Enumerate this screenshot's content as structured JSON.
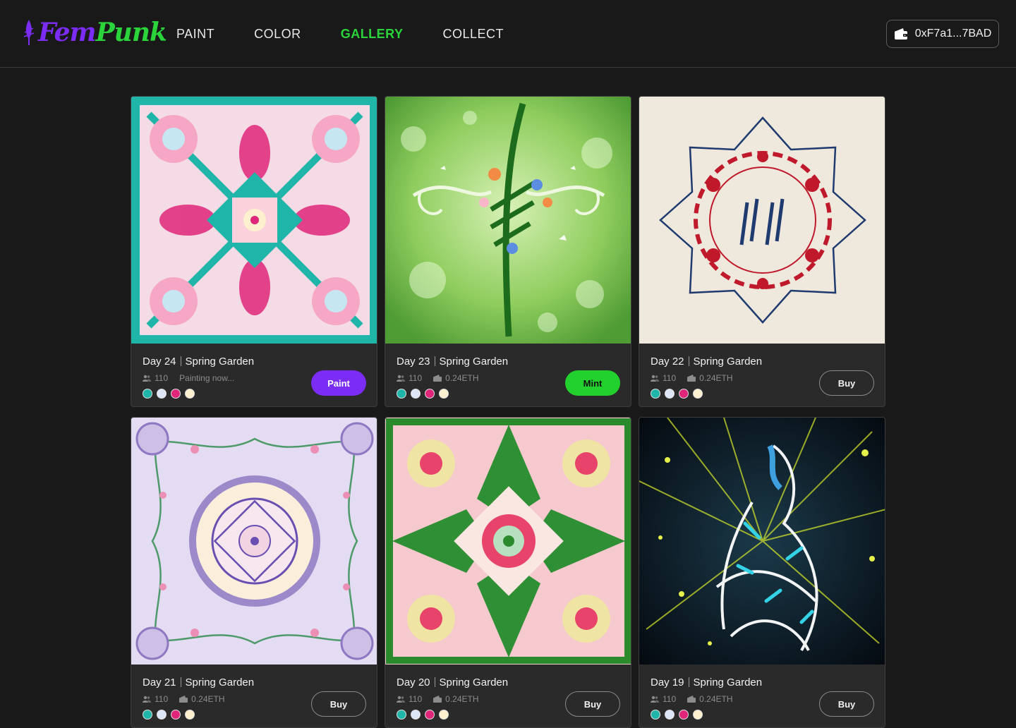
{
  "brand": {
    "fem": "Fem",
    "punk": "Punk",
    "accent_purple": "#7b2cf5",
    "accent_green": "#2ad43a"
  },
  "nav": [
    {
      "label": "PAINT",
      "active": false
    },
    {
      "label": "COLOR",
      "active": false
    },
    {
      "label": "GALLERY",
      "active": true
    },
    {
      "label": "COLLECT",
      "active": false
    }
  ],
  "wallet": {
    "address": "0xF7a1...7BAD",
    "icon": "wallet-icon"
  },
  "cards": [
    {
      "day": "Day 24",
      "series": "Spring Garden",
      "count": "110",
      "status": "Painting now...",
      "button": "Paint",
      "swatches": [
        "#1fb5a8",
        "#dce6f7",
        "#e0267a",
        "#fdf0cf"
      ]
    },
    {
      "day": "Day 23",
      "series": "Spring Garden",
      "count": "110",
      "status": "0.24ETH",
      "button": "Mint",
      "swatches": [
        "#1fb5a8",
        "#dce6f7",
        "#e0267a",
        "#fdf0cf"
      ]
    },
    {
      "day": "Day 22",
      "series": "Spring Garden",
      "count": "110",
      "status": "0.24ETH",
      "button": "Buy",
      "swatches": [
        "#1fb5a8",
        "#dce6f7",
        "#e0267a",
        "#fdf0cf"
      ]
    },
    {
      "day": "Day 21",
      "series": "Spring Garden",
      "count": "110",
      "status": "0.24ETH",
      "button": "Buy",
      "swatches": [
        "#1fb5a8",
        "#dce6f7",
        "#e0267a",
        "#fdf0cf"
      ]
    },
    {
      "day": "Day 20",
      "series": "Spring Garden",
      "count": "110",
      "status": "0.24ETH",
      "button": "Buy",
      "swatches": [
        "#1fb5a8",
        "#dce6f7",
        "#e0267a",
        "#fdf0cf"
      ]
    },
    {
      "day": "Day 19",
      "series": "Spring Garden",
      "count": "110",
      "status": "0.24ETH",
      "button": "Buy",
      "swatches": [
        "#1fb5a8",
        "#dce6f7",
        "#e0267a",
        "#fdf0cf"
      ]
    }
  ]
}
